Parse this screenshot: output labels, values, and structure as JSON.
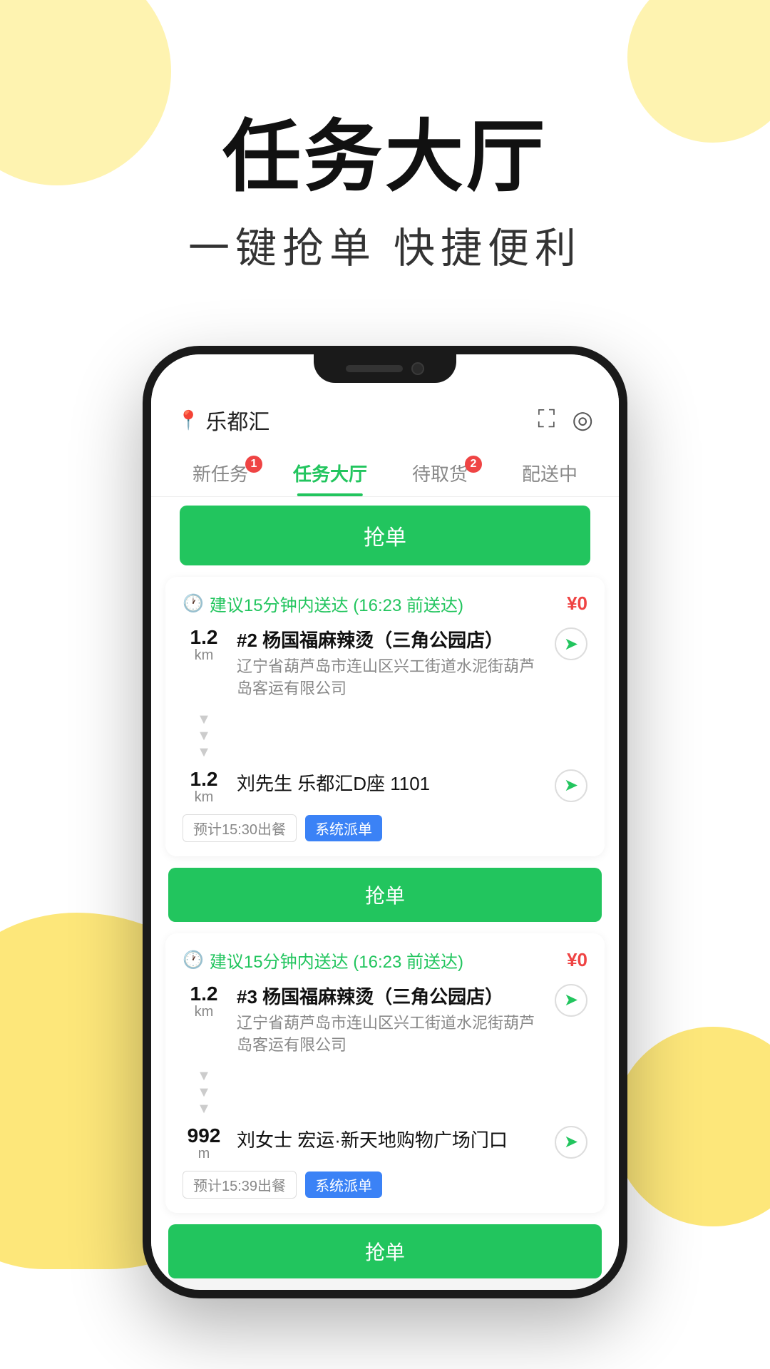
{
  "page": {
    "bg_blobs": [
      "top-left",
      "top-right",
      "bottom-left",
      "bottom-right"
    ]
  },
  "header": {
    "main_title": "任务大厅",
    "sub_title": "一键抢单  快捷便利"
  },
  "phone": {
    "location": "乐都汇",
    "tabs": [
      {
        "id": "new",
        "label": "新任务",
        "badge": "1",
        "active": false
      },
      {
        "id": "hall",
        "label": "任务大厅",
        "badge": null,
        "active": true
      },
      {
        "id": "pickup",
        "label": "待取货",
        "badge": "2",
        "active": false
      },
      {
        "id": "delivering",
        "label": "配送中",
        "badge": null,
        "active": false
      }
    ],
    "top_grab_btn": "抢单",
    "orders": [
      {
        "id": "order-1",
        "time_tip": "建议15分钟内送达 (16:23 前送达)",
        "price": "¥0",
        "shop_distance": "1.2",
        "shop_distance_unit": "km",
        "shop_name": "#2 杨国福麻辣烫（三角公园店）",
        "shop_addr": "辽宁省葫芦岛市连山区兴工街道水泥街葫芦岛客运有限公司",
        "deliver_distance": "1.2",
        "deliver_distance_unit": "km",
        "deliver_addr": "刘先生 乐都汇D座 1101",
        "tag1": "预计15:30出餐",
        "tag2": "系统派单",
        "grab_btn": "抢单"
      },
      {
        "id": "order-2",
        "time_tip": "建议15分钟内送达 (16:23 前送达)",
        "price": "¥0",
        "shop_distance": "1.2",
        "shop_distance_unit": "km",
        "shop_name": "#3 杨国福麻辣烫（三角公园店）",
        "shop_addr": "辽宁省葫芦岛市连山区兴工街道水泥街葫芦岛客运有限公司",
        "deliver_distance": "992",
        "deliver_distance_unit": "m",
        "deliver_addr": "刘女士 宏运·新天地购物广场门口",
        "tag1": "预计15:39出餐",
        "tag2": "系统派单",
        "grab_btn": "抢单"
      }
    ]
  }
}
